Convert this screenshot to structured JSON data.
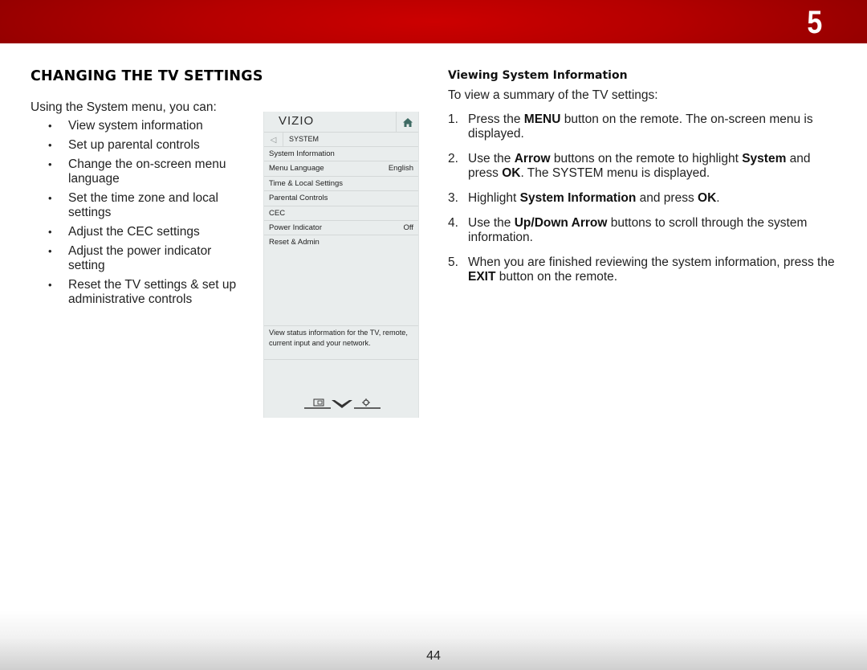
{
  "header": {
    "chapter_number": "5",
    "bar_color": "#c00000"
  },
  "left": {
    "title": "CHANGING THE TV SETTINGS",
    "intro": "Using the System menu, you can:",
    "bullet_glyph": "•",
    "bullets": [
      "View system information",
      "Set up parental controls",
      "Change the on-screen menu language",
      "Set the time zone and local settings",
      "Adjust the CEC settings",
      "Adjust the power indicator setting",
      "Reset the TV settings & set up administrative controls"
    ]
  },
  "tv_menu": {
    "logo": "VIZIO",
    "home_icon": "home-icon",
    "back_icon": "◁",
    "section": "SYSTEM",
    "items": [
      {
        "label": "System Information",
        "value": ""
      },
      {
        "label": "Menu Language",
        "value": "English"
      },
      {
        "label": "Time & Local Settings",
        "value": ""
      },
      {
        "label": "Parental Controls",
        "value": ""
      },
      {
        "label": "CEC",
        "value": ""
      },
      {
        "label": "Power Indicator",
        "value": "Off"
      },
      {
        "label": "Reset & Admin",
        "value": ""
      }
    ],
    "description": "View status information for the TV, remote, current input and your network.",
    "bottom_icons": [
      "input-icon",
      "vizio-v-icon",
      "settings-gear-icon"
    ]
  },
  "right": {
    "subtitle": "Viewing System Information",
    "lead": "To view a summary of the TV settings:",
    "steps": [
      {
        "num": "1.",
        "parts": [
          "Press the ",
          "MENU",
          " button on the remote. The on-screen menu is displayed."
        ]
      },
      {
        "num": "2.",
        "parts": [
          "Use the ",
          "Arrow",
          " buttons on the remote to highlight ",
          "System",
          " and press ",
          "OK",
          ". The SYSTEM menu is displayed."
        ]
      },
      {
        "num": "3.",
        "parts": [
          "Highlight ",
          "System Information",
          " and press ",
          "OK",
          "."
        ]
      },
      {
        "num": "4.",
        "parts": [
          "Use the ",
          "Up/Down Arrow",
          " buttons to scroll through the system information."
        ]
      },
      {
        "num": "5.",
        "parts": [
          "When you are finished reviewing the system information, press the ",
          "EXIT",
          " button on the remote."
        ]
      }
    ]
  },
  "footer": {
    "page_number": "44"
  }
}
